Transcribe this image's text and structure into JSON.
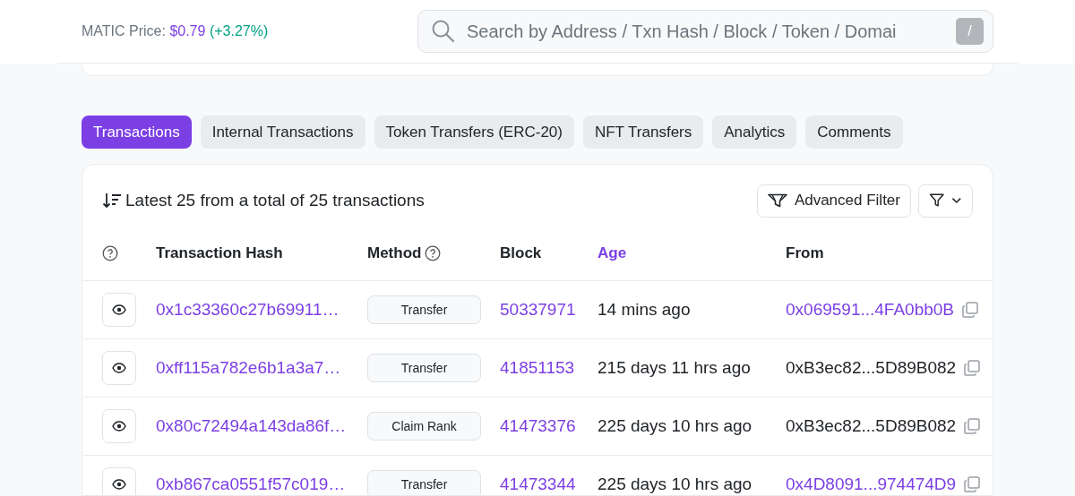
{
  "header": {
    "price_label": "MATIC Price:",
    "price": "$0.79",
    "change": "(+3.27%)",
    "search": {
      "placeholder": "Search by Address / Txn Hash / Block / Token / Domai",
      "shortcut": "/"
    }
  },
  "tabs": [
    {
      "label": "Transactions",
      "selected": true
    },
    {
      "label": "Internal Transactions",
      "selected": false
    },
    {
      "label": "Token Transfers (ERC-20)",
      "selected": false
    },
    {
      "label": "NFT Transfers",
      "selected": false
    },
    {
      "label": "Analytics",
      "selected": false
    },
    {
      "label": "Comments",
      "selected": false
    }
  ],
  "summary": "Latest 25 from a total of 25 transactions",
  "advanced_filter": "Advanced Filter",
  "table": {
    "columns": [
      {
        "label": "Transaction Hash",
        "help": false,
        "sorted": false
      },
      {
        "label": "Method",
        "help": true,
        "sorted": false
      },
      {
        "label": "Block",
        "help": false,
        "sorted": false
      },
      {
        "label": "Age",
        "help": false,
        "sorted": true
      },
      {
        "label": "From",
        "help": false,
        "sorted": false
      }
    ],
    "rows": [
      {
        "hash": "0x1c33360c27b69911…",
        "method": "Transfer",
        "block": "50337971",
        "age": "14 mins ago",
        "from": "0x069591...4FA0bb0B",
        "from_linked": true
      },
      {
        "hash": "0xff115a782e6b1a3a7…",
        "method": "Transfer",
        "block": "41851153",
        "age": "215 days 11 hrs ago",
        "from": "0xB3ec82...5D89B082",
        "from_linked": false
      },
      {
        "hash": "0x80c72494a143da86f…",
        "method": "Claim Rank",
        "block": "41473376",
        "age": "225 days 10 hrs ago",
        "from": "0xB3ec82...5D89B082",
        "from_linked": false
      },
      {
        "hash": "0xb867ca0551f57c019…",
        "method": "Transfer",
        "block": "41473344",
        "age": "225 days 10 hrs ago",
        "from": "0x4D8091...974474D9",
        "from_linked": true
      }
    ]
  }
}
